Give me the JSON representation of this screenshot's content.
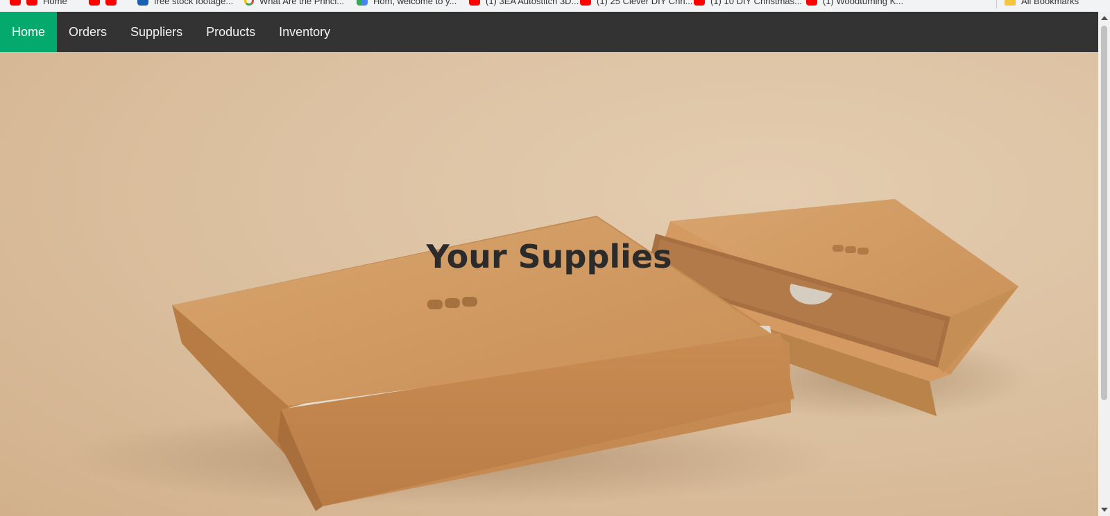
{
  "bookmarks": [
    {
      "label": "Home",
      "icon": "youtube-icon"
    },
    {
      "label": "",
      "icon": "youtube-icon"
    },
    {
      "label": "free stock footage...",
      "icon": "vimeo-icon"
    },
    {
      "label": "What Are the Princi...",
      "icon": "google-icon"
    },
    {
      "label": "Hom, welcome to y...",
      "icon": "apps-icon"
    },
    {
      "label": "(1) 3EA Autostitch 3D...",
      "icon": "youtube-icon"
    },
    {
      "label": "(1) 25 Clever DIY Chri...",
      "icon": "youtube-icon"
    },
    {
      "label": "(1) 10 DIY Christmas...",
      "icon": "youtube-icon"
    },
    {
      "label": "(1) Woodturning K...",
      "icon": "youtube-icon"
    }
  ],
  "all_bookmarks_label": "All Bookmarks",
  "nav": {
    "items": [
      {
        "label": "Home",
        "active": true
      },
      {
        "label": "Orders",
        "active": false
      },
      {
        "label": "Suppliers",
        "active": false
      },
      {
        "label": "Products",
        "active": false
      },
      {
        "label": "Inventory",
        "active": false
      }
    ],
    "active_color": "#04aa6d",
    "bar_color": "#333333"
  },
  "hero": {
    "title": "Your Supplies",
    "image_description_icon": "kraft-box-image"
  }
}
